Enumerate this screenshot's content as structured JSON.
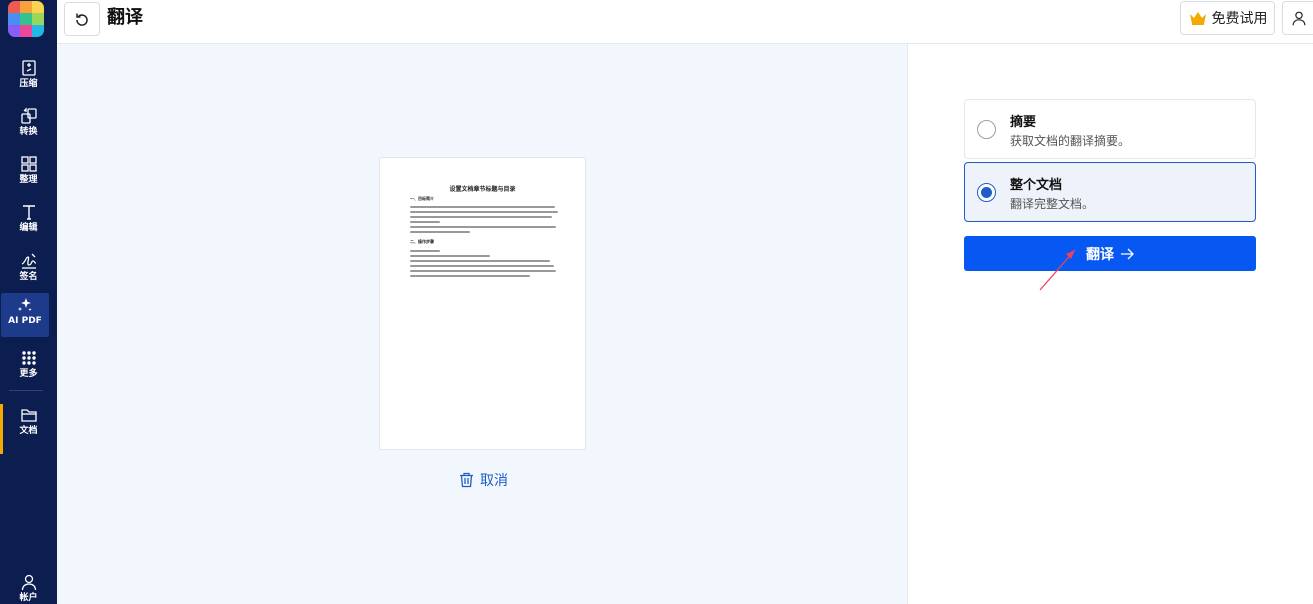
{
  "header": {
    "title": "翻译",
    "trial_label": "免费试用"
  },
  "sidebar": {
    "items": [
      {
        "label": "压缩",
        "icon": "compress-icon"
      },
      {
        "label": "转换",
        "icon": "convert-icon"
      },
      {
        "label": "整理",
        "icon": "organize-icon"
      },
      {
        "label": "编辑",
        "icon": "edit-text-icon"
      },
      {
        "label": "签名",
        "icon": "signature-icon"
      },
      {
        "label": "AI PDF",
        "icon": "sparkle-icon"
      },
      {
        "label": "更多",
        "icon": "grid-dots-icon"
      },
      {
        "label": "文档",
        "icon": "folder-icon"
      },
      {
        "label": "帐户",
        "icon": "user-icon"
      }
    ],
    "active": "AI PDF"
  },
  "preview": {
    "doc_title": "设置文档章节标题与目录",
    "section1": "一、目标简介",
    "section2": "二、操作步骤",
    "cancel_label": "取消"
  },
  "options": [
    {
      "title": "摘要",
      "desc": "获取文档的翻译摘要。",
      "selected": false
    },
    {
      "title": "整个文档",
      "desc": "翻译完整文档。",
      "selected": true
    }
  ],
  "actions": {
    "translate_label": "翻译"
  },
  "colors": {
    "sidebar_bg": "#0c1e4f",
    "accent": "#0758f2",
    "highlight": "#f2a900",
    "preview_bg": "#f2f6fd"
  }
}
